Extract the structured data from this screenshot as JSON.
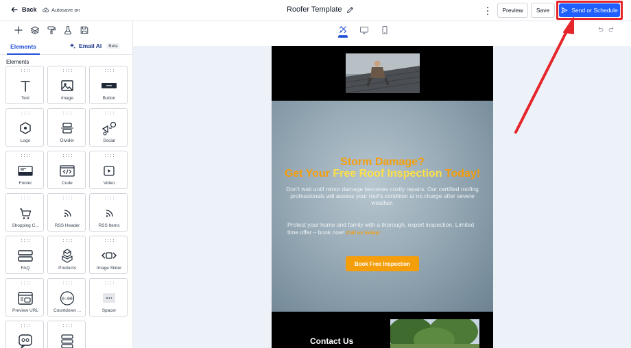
{
  "topbar": {
    "back_label": "Back",
    "autosave_label": "Autosave on",
    "title": "Roofer Template",
    "preview_label": "Preview",
    "save_label": "Save",
    "send_label": "Send or Schedule"
  },
  "left_panel": {
    "tools": [
      "add-icon",
      "layers-icon",
      "paint-roller-icon",
      "flask-icon",
      "save-icon"
    ],
    "tabs": {
      "elements_label": "Elements",
      "email_ai_label": "Email AI",
      "beta_label": "Beta"
    },
    "section_title": "Elements",
    "elements": [
      {
        "label": "Text",
        "icon": "text-icon"
      },
      {
        "label": "Image",
        "icon": "image-icon"
      },
      {
        "label": "Button",
        "icon": "button-icon"
      },
      {
        "label": "Logo",
        "icon": "logo-icon"
      },
      {
        "label": "Divider",
        "icon": "divider-icon"
      },
      {
        "label": "Social",
        "icon": "social-icon"
      },
      {
        "label": "Footer",
        "icon": "footer-icon"
      },
      {
        "label": "Code",
        "icon": "code-icon"
      },
      {
        "label": "Video",
        "icon": "video-icon"
      },
      {
        "label": "Shopping C...",
        "icon": "cart-icon"
      },
      {
        "label": "RSS Header",
        "icon": "rss-icon"
      },
      {
        "label": "RSS Items",
        "icon": "rss-icon"
      },
      {
        "label": "FAQ",
        "icon": "faq-icon"
      },
      {
        "label": "Products",
        "icon": "products-icon"
      },
      {
        "label": "Image Slider",
        "icon": "slider-icon"
      },
      {
        "label": "Preview URL",
        "icon": "preview-url-icon"
      },
      {
        "label": "Countdown ...",
        "icon": "countdown-icon"
      },
      {
        "label": "Spacer",
        "icon": "spacer-icon"
      },
      {
        "label": "",
        "icon": "chat-icon"
      },
      {
        "label": "",
        "icon": "stack-icon"
      }
    ]
  },
  "viewbar": {
    "modes": [
      "design-icon",
      "desktop-icon",
      "mobile-icon"
    ],
    "active_mode": "design-icon"
  },
  "email": {
    "headline_line1": "Storm Damage?",
    "headline_line2": {
      "a": "Get Your ",
      "b": "Free Roof Inspection",
      "c": " Today!"
    },
    "body1": "Don’t wait until minor damage becomes costly repairs. Our certified roofing professionals will assess your roof’s condition at no charge after severe weather.",
    "body2": "Protect your home and family with a thorough, expert inspection. Limited time offer – book now! ",
    "body2_cta": "Call us today!",
    "button_label": "Book Free Inspection",
    "contact_heading": "Contact Us"
  },
  "colors": {
    "accent_blue": "#1f5eff",
    "highlight_red": "#e5252a",
    "orange": "#f59e0b",
    "yellow": "#fde047",
    "canvas_bg": "#edf1f8"
  }
}
